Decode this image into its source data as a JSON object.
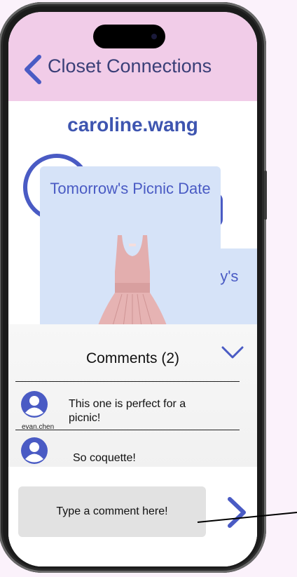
{
  "header": {
    "title": "Closet Connections",
    "back_icon": "chevron-left-icon",
    "background": "#f1cce8"
  },
  "profile": {
    "username": "caroline.wang"
  },
  "outfits": {
    "current_title": "Tomorrow's Picnic Date",
    "next_title_partial": "ay's"
  },
  "comments": {
    "header": "Comments (2)",
    "collapse_icon": "chevron-down-icon",
    "items": [
      {
        "author": "evan.chen",
        "text": "This one is perfect for a picnic!"
      },
      {
        "author": "",
        "text": "So coquette!"
      }
    ]
  },
  "composer": {
    "placeholder": "Type a comment here!",
    "send_icon": "chevron-right-icon"
  },
  "colors": {
    "accent": "#4a5bc4",
    "card": "#d6e3f8",
    "header_bg": "#f1cce8",
    "page_bg": "#fbf2fb"
  }
}
